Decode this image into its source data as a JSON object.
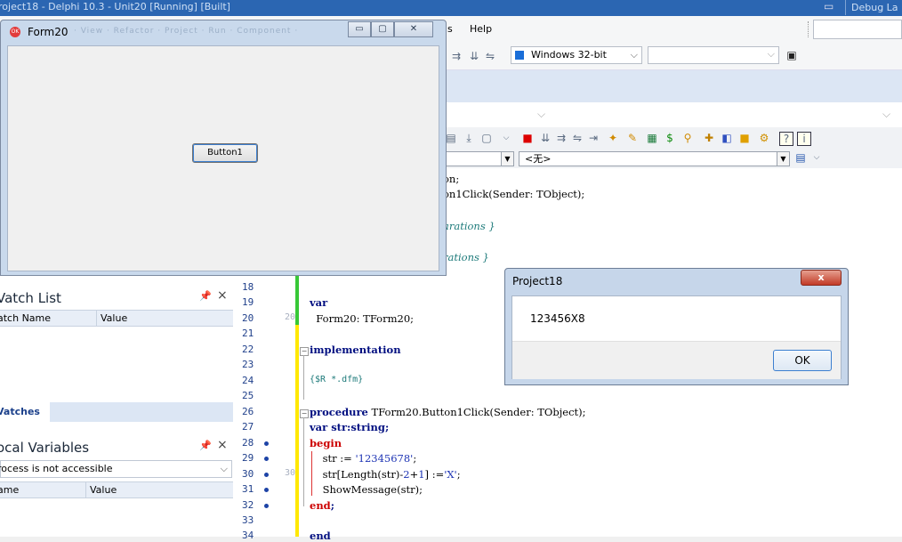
{
  "ide": {
    "title": "roject18 - Delphi 10.3 - Unit20 [Running] [Built]",
    "layout": "Debug La",
    "menu_help": "Help",
    "menu_tools_fragment": "s"
  },
  "toolbar": {
    "platform": "Windows 32-bit"
  },
  "editor": {
    "combo_right": "<无>",
    "above_lines": [
      {
        "text": "on;"
      },
      {
        "text": "on1Click(Sender: TObject);"
      },
      {
        "text": "arations }"
      },
      {
        "text": "rations }"
      }
    ],
    "line_numbers": [
      "18",
      "19",
      "20",
      "21",
      "22",
      "23",
      "24",
      "25",
      "26",
      "27",
      "28",
      "29",
      "30",
      "31",
      "32",
      "33",
      "34"
    ],
    "break_marks": [
      "20",
      "30"
    ],
    "code": {
      "l19_kw": "var",
      "l20": "  Form20: TForm20;",
      "l22_kw": "implementation",
      "l24": "{$R *.dfm}",
      "l26_kw": "procedure",
      "l26_rest": " TForm20.Button1Click(Sender: TObject);",
      "l27_kw1": "var",
      "l27_mid": " str:",
      "l27_kw2": "string",
      "l27_end": ";",
      "l28_kw": "begin",
      "l29_a": "    str := ",
      "l29_str": "'12345678'",
      "l29_end": ";",
      "l30_a": "    str[Length(str)-",
      "l30_n1": "2",
      "l30_b": "+",
      "l30_n2": "1",
      "l30_c": "] :=",
      "l30_str": "'X'",
      "l30_end": ";",
      "l31": "    ShowMessage(str);",
      "l32_kw": "end",
      "l32_end": ";",
      "l34_kw": "end"
    }
  },
  "watch_list": {
    "title": "Vatch List",
    "col_name": "atch Name",
    "col_value": "Value",
    "tab": "Vatches"
  },
  "local_variables": {
    "title": "ocal Variables",
    "combo": "rocess is not accessible",
    "col_name": "ame",
    "col_value": "Value"
  },
  "form20": {
    "title": "Form20",
    "button1": "Button1"
  },
  "msgbox": {
    "title": "Project18",
    "message": "123456X8",
    "ok": "OK",
    "close": "x"
  }
}
